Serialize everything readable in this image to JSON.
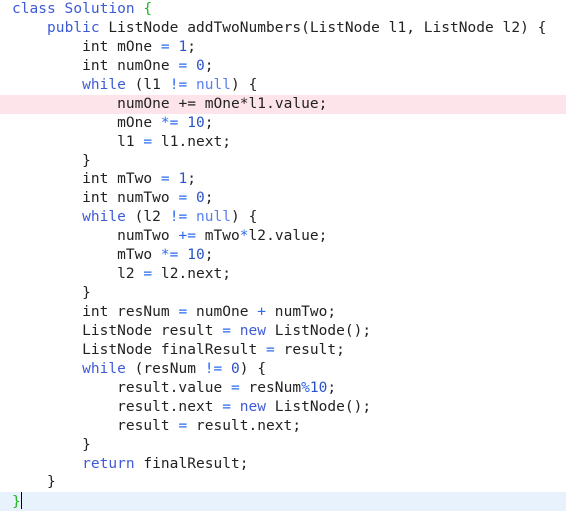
{
  "editor": {
    "language": "java",
    "lines": [
      {
        "state": "normal",
        "tokens": [
          [
            "kw",
            "class Solution "
          ],
          [
            "brace-match",
            "{"
          ]
        ]
      },
      {
        "state": "normal",
        "tokens": [
          [
            "plain",
            "    "
          ],
          [
            "kw",
            "public"
          ],
          [
            "plain",
            " ListNode addTwoNumbers(ListNode l1, ListNode l2) {"
          ]
        ]
      },
      {
        "state": "normal",
        "tokens": [
          [
            "plain",
            "        int mOne "
          ],
          [
            "op",
            "="
          ],
          [
            "plain",
            " "
          ],
          [
            "num",
            "1"
          ],
          [
            "plain",
            ";"
          ]
        ]
      },
      {
        "state": "normal",
        "tokens": [
          [
            "plain",
            "        int numOne "
          ],
          [
            "op",
            "="
          ],
          [
            "plain",
            " "
          ],
          [
            "num",
            "0"
          ],
          [
            "plain",
            ";"
          ]
        ]
      },
      {
        "state": "normal",
        "tokens": [
          [
            "plain",
            "        "
          ],
          [
            "kw",
            "while"
          ],
          [
            "plain",
            " (l1 "
          ],
          [
            "op",
            "!="
          ],
          [
            "plain",
            " "
          ],
          [
            "null",
            "null"
          ],
          [
            "plain",
            ") {"
          ]
        ]
      },
      {
        "state": "error",
        "tokens": [
          [
            "plain",
            "            numOne "
          ],
          [
            "op",
            "+="
          ],
          [
            "plain",
            " mOne"
          ],
          [
            "op",
            "*"
          ],
          [
            "plain",
            "l1.value;"
          ]
        ]
      },
      {
        "state": "normal",
        "tokens": [
          [
            "plain",
            "            mOne "
          ],
          [
            "op",
            "*="
          ],
          [
            "plain",
            " "
          ],
          [
            "num",
            "10"
          ],
          [
            "plain",
            ";"
          ]
        ]
      },
      {
        "state": "normal",
        "tokens": [
          [
            "plain",
            "            l1 "
          ],
          [
            "op",
            "="
          ],
          [
            "plain",
            " l1.next;"
          ]
        ]
      },
      {
        "state": "normal",
        "tokens": [
          [
            "plain",
            "        }"
          ]
        ]
      },
      {
        "state": "normal",
        "tokens": [
          [
            "plain",
            "        int mTwo "
          ],
          [
            "op",
            "="
          ],
          [
            "plain",
            " "
          ],
          [
            "num",
            "1"
          ],
          [
            "plain",
            ";"
          ]
        ]
      },
      {
        "state": "normal",
        "tokens": [
          [
            "plain",
            "        int numTwo "
          ],
          [
            "op",
            "="
          ],
          [
            "plain",
            " "
          ],
          [
            "num",
            "0"
          ],
          [
            "plain",
            ";"
          ]
        ]
      },
      {
        "state": "normal",
        "tokens": [
          [
            "plain",
            "        "
          ],
          [
            "kw",
            "while"
          ],
          [
            "plain",
            " (l2 "
          ],
          [
            "op",
            "!="
          ],
          [
            "plain",
            " "
          ],
          [
            "null",
            "null"
          ],
          [
            "plain",
            ") {"
          ]
        ]
      },
      {
        "state": "normal",
        "tokens": [
          [
            "plain",
            "            numTwo "
          ],
          [
            "op",
            "+="
          ],
          [
            "plain",
            " mTwo"
          ],
          [
            "op",
            "*"
          ],
          [
            "plain",
            "l2.value;"
          ]
        ]
      },
      {
        "state": "normal",
        "tokens": [
          [
            "plain",
            "            mTwo "
          ],
          [
            "op",
            "*="
          ],
          [
            "plain",
            " "
          ],
          [
            "num",
            "10"
          ],
          [
            "plain",
            ";"
          ]
        ]
      },
      {
        "state": "normal",
        "tokens": [
          [
            "plain",
            "            l2 "
          ],
          [
            "op",
            "="
          ],
          [
            "plain",
            " l2.next;"
          ]
        ]
      },
      {
        "state": "normal",
        "tokens": [
          [
            "plain",
            "        }"
          ]
        ]
      },
      {
        "state": "normal",
        "tokens": [
          [
            "plain",
            "        int resNum "
          ],
          [
            "op",
            "="
          ],
          [
            "plain",
            " numOne "
          ],
          [
            "op",
            "+"
          ],
          [
            "plain",
            " numTwo;"
          ]
        ]
      },
      {
        "state": "normal",
        "tokens": [
          [
            "plain",
            "        ListNode result "
          ],
          [
            "op",
            "="
          ],
          [
            "plain",
            " "
          ],
          [
            "kw",
            "new"
          ],
          [
            "plain",
            " ListNode();"
          ]
        ]
      },
      {
        "state": "normal",
        "tokens": [
          [
            "plain",
            "        ListNode finalResult "
          ],
          [
            "op",
            "="
          ],
          [
            "plain",
            " result;"
          ]
        ]
      },
      {
        "state": "normal",
        "tokens": [
          [
            "plain",
            "        "
          ],
          [
            "kw",
            "while"
          ],
          [
            "plain",
            " (resNum "
          ],
          [
            "op",
            "!="
          ],
          [
            "plain",
            " "
          ],
          [
            "num",
            "0"
          ],
          [
            "plain",
            ") {"
          ]
        ]
      },
      {
        "state": "normal",
        "tokens": [
          [
            "plain",
            "            result.value "
          ],
          [
            "op",
            "="
          ],
          [
            "plain",
            " resNum"
          ],
          [
            "op",
            "%"
          ],
          [
            "num",
            "10"
          ],
          [
            "plain",
            ";"
          ]
        ]
      },
      {
        "state": "normal",
        "tokens": [
          [
            "plain",
            "            result.next "
          ],
          [
            "op",
            "="
          ],
          [
            "plain",
            " "
          ],
          [
            "kw",
            "new"
          ],
          [
            "plain",
            " ListNode();"
          ]
        ]
      },
      {
        "state": "normal",
        "tokens": [
          [
            "plain",
            "            result "
          ],
          [
            "op",
            "="
          ],
          [
            "plain",
            " result.next;"
          ]
        ]
      },
      {
        "state": "normal",
        "tokens": [
          [
            "plain",
            "        }"
          ]
        ]
      },
      {
        "state": "normal",
        "tokens": [
          [
            "plain",
            "        "
          ],
          [
            "kw",
            "return"
          ],
          [
            "plain",
            " finalResult;"
          ]
        ]
      },
      {
        "state": "normal",
        "tokens": [
          [
            "plain",
            "    }"
          ]
        ]
      },
      {
        "state": "current",
        "tokens": [
          [
            "brace-match",
            "}"
          ]
        ],
        "cursor": true
      }
    ]
  },
  "colors": {
    "error_line_bg": "#fde4ea",
    "current_line_bg": "#e8f2fd",
    "keyword": "#3d5bd6",
    "operator": "#2a6af0",
    "number": "#2a52c9",
    "null_literal": "#5a7ff0",
    "brace_match": "#1eb81e",
    "text": "#222222"
  }
}
